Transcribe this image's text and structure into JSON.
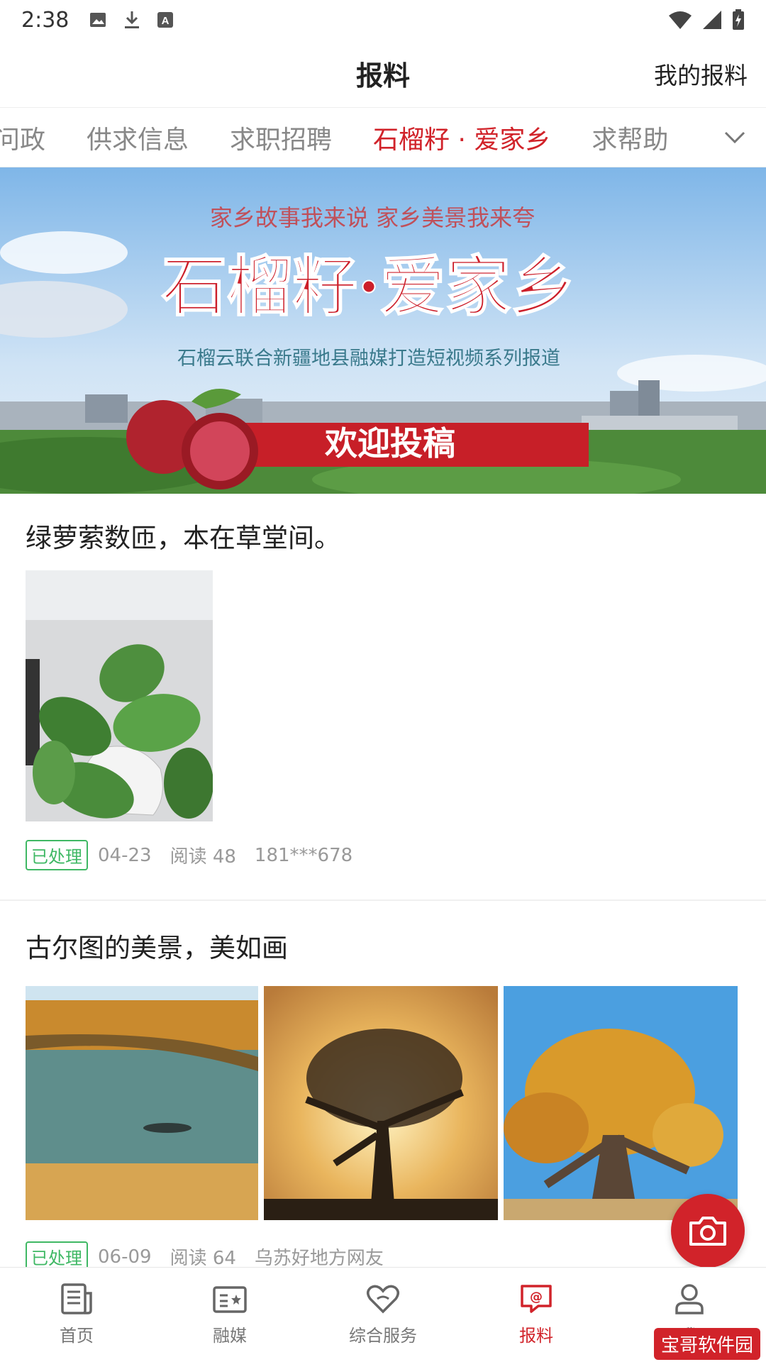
{
  "status": {
    "time": "2:38"
  },
  "header": {
    "title": "报料",
    "right_link": "我的报料"
  },
  "tabs": [
    {
      "label": "问政"
    },
    {
      "label": "供求信息"
    },
    {
      "label": "求职招聘"
    },
    {
      "label": "石榴籽 · 爱家乡",
      "active": true
    },
    {
      "label": "求帮助"
    }
  ],
  "banner": {
    "tagline": "家乡故事我来说 家乡美景我来夸",
    "headline": "石榴籽·爱家乡",
    "subtitle": "石榴云联合新疆地县融媒打造短视频系列报道",
    "cta": "欢迎投稿"
  },
  "posts": [
    {
      "title": "绿萝萦数匝，本在草堂间。",
      "status": "已处理",
      "date": "04-23",
      "reads": "阅读 48",
      "author": "181***678"
    },
    {
      "title": "古尔图的美景，美如画",
      "status": "已处理",
      "date": "06-09",
      "reads": "阅读 64",
      "author": "乌苏好地方网友"
    }
  ],
  "nav": [
    {
      "label": "首页",
      "icon": "newspaper-icon"
    },
    {
      "label": "融媒",
      "icon": "media-card-icon"
    },
    {
      "label": "综合服务",
      "icon": "heart-service-icon"
    },
    {
      "label": "报料",
      "icon": "report-chat-icon",
      "active": true
    },
    {
      "label": "我",
      "icon": "user-icon"
    }
  ],
  "watermark": "宝哥软件园",
  "colors": {
    "accent": "#d1232a",
    "processed": "#3fb864"
  }
}
